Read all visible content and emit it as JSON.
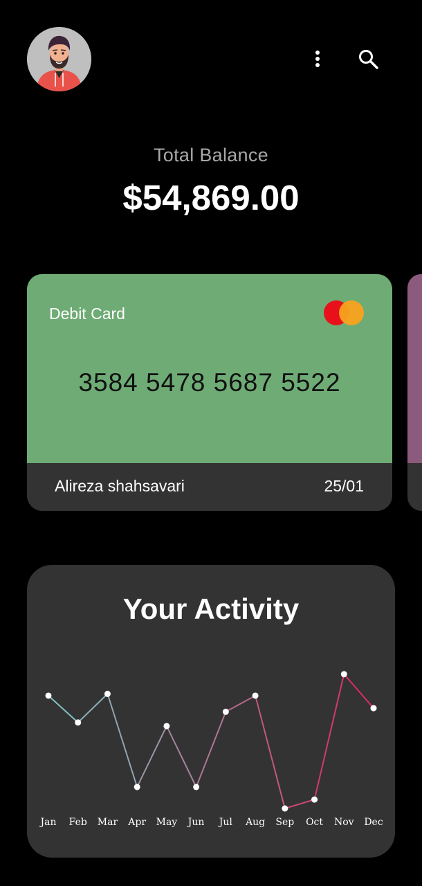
{
  "header": {
    "avatar_name": "user-avatar",
    "menu_icon": "more-vertical-icon",
    "search_icon": "search-icon"
  },
  "balance": {
    "label": "Total Balance",
    "amount": "$54,869.00"
  },
  "card": {
    "type": "Debit Card",
    "number": "3584 5478 5687 5522",
    "holder": "Alireza shahsavari",
    "expiry": "25/01",
    "network_icon": "mastercard-logo",
    "color": "#6eab75"
  },
  "next_card": {
    "color": "#8b5a7c"
  },
  "activity": {
    "title": "Your Activity"
  },
  "chart_data": {
    "type": "line",
    "categories": [
      "Jan",
      "Feb",
      "Mar",
      "Apr",
      "May",
      "Jun",
      "Jul",
      "Aug",
      "Sep",
      "Oct",
      "Nov",
      "Dec"
    ],
    "series": [
      {
        "values": [
          63,
          48,
          64,
          12,
          46,
          12,
          54,
          63,
          0,
          5,
          75,
          56
        ]
      }
    ],
    "ylim": [
      0,
      80
    ],
    "grid": false,
    "colors": {
      "start": "#7ec8c8",
      "end": "#e0245e"
    }
  }
}
